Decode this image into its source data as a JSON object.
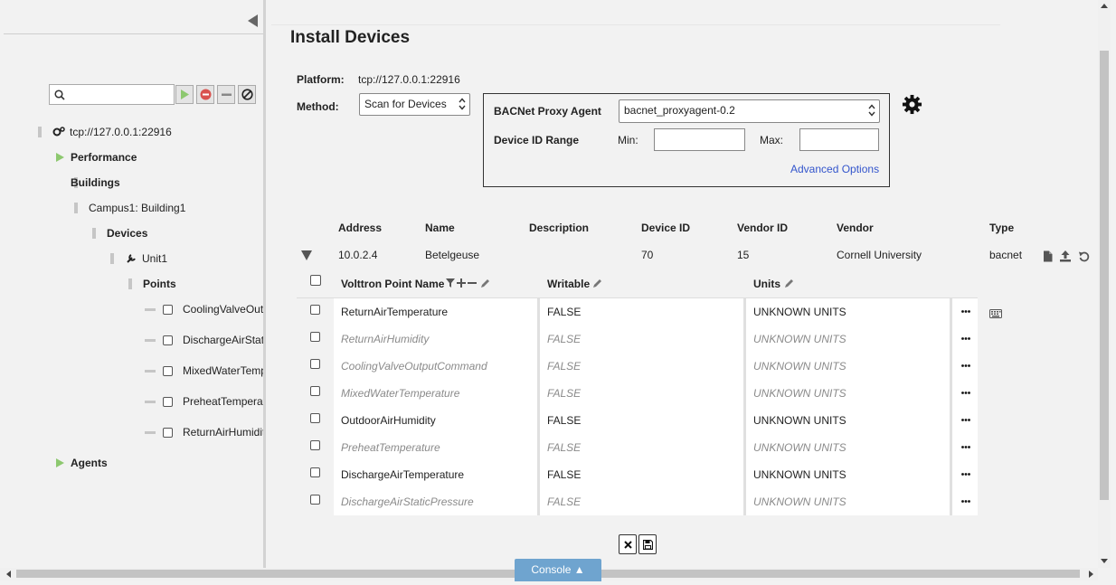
{
  "page": {
    "title": "Install Devices"
  },
  "sidebar": {
    "search_placeholder": "",
    "tree": {
      "platform": "tcp://127.0.0.1:22916",
      "performance": "Performance",
      "buildings": "Buildings",
      "building": "Campus1: Building1",
      "devices": "Devices",
      "unit": "Unit1",
      "points": "Points",
      "point_items": [
        "CoolingValveOutputCommand",
        "DischargeAirStaticPressure",
        "MixedWaterTemperature",
        "PreheatTemperature",
        "ReturnAirHumidity"
      ],
      "agents": "Agents"
    }
  },
  "form": {
    "platform_label": "Platform:",
    "platform_value": "tcp://127.0.0.1:22916",
    "method_label": "Method:",
    "method_value": "Scan for Devices",
    "proxy_label": "BACNet Proxy Agent",
    "proxy_value": "bacnet_proxyagent-0.2",
    "range_label": "Device ID Range",
    "min_label": "Min:",
    "max_label": "Max:",
    "min_value": "",
    "max_value": "",
    "advanced_link": "Advanced Options"
  },
  "device_table": {
    "headers": [
      "Address",
      "Name",
      "Description",
      "Device ID",
      "Vendor ID",
      "Vendor",
      "Type"
    ],
    "row": {
      "address": "10.0.2.4",
      "name": "Betelgeuse",
      "description": "",
      "device_id": "70",
      "vendor_id": "15",
      "vendor": "Cornell University",
      "type": "bacnet"
    }
  },
  "points_grid": {
    "headers": {
      "name": "Volttron Point Name",
      "writable": "Writable",
      "units": "Units"
    },
    "rows": [
      {
        "name": "ReturnAirTemperature",
        "writable": "FALSE",
        "units": "UNKNOWN UNITS",
        "dim": false
      },
      {
        "name": "ReturnAirHumidity",
        "writable": "FALSE",
        "units": "UNKNOWN UNITS",
        "dim": true
      },
      {
        "name": "CoolingValveOutputCommand",
        "writable": "FALSE",
        "units": "UNKNOWN UNITS",
        "dim": true
      },
      {
        "name": "MixedWaterTemperature",
        "writable": "FALSE",
        "units": "UNKNOWN UNITS",
        "dim": true
      },
      {
        "name": "OutdoorAirHumidity",
        "writable": "FALSE",
        "units": "UNKNOWN UNITS",
        "dim": false
      },
      {
        "name": "PreheatTemperature",
        "writable": "FALSE",
        "units": "UNKNOWN UNITS",
        "dim": true
      },
      {
        "name": "DischargeAirTemperature",
        "writable": "FALSE",
        "units": "UNKNOWN UNITS",
        "dim": false
      },
      {
        "name": "DischargeAirStaticPressure",
        "writable": "FALSE",
        "units": "UNKNOWN UNITS",
        "dim": true
      }
    ]
  },
  "console": {
    "label": "Console ▲"
  },
  "colors": {
    "accent_green": "#8dc86f",
    "link_blue": "#3355cc",
    "console_blue": "#6fa4cf"
  }
}
